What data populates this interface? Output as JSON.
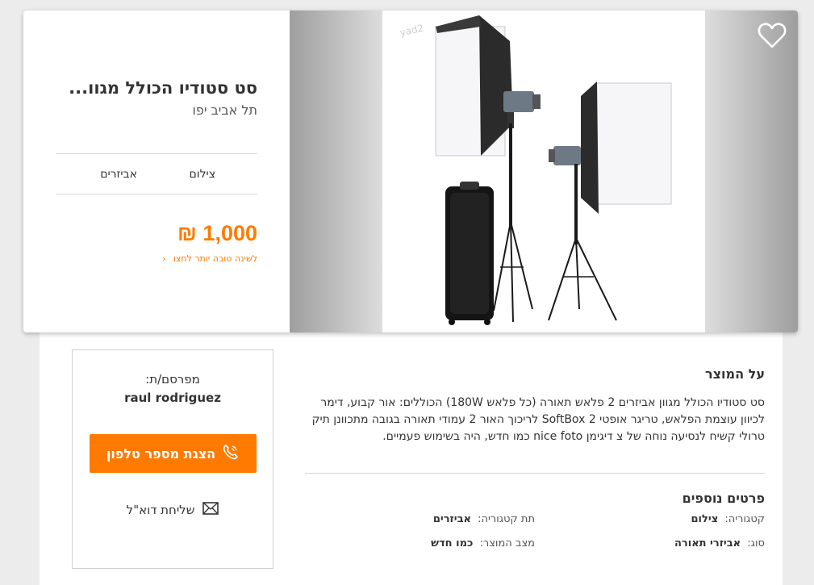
{
  "listing": {
    "title": "סט סטודיו הכולל מגוו...",
    "location": "תל אביב יפו",
    "category": "צילום",
    "subcategory": "אביזרים",
    "price": "1,000 ₪",
    "price_hint": "לשינה טובה יותר לחצו",
    "watermark": "yad2"
  },
  "seller": {
    "label": "מפרסם/ת:",
    "name": "raul rodriguez",
    "phone_button": "הצגת מספר טלפון",
    "email_button": "שליחת דוא\"ל"
  },
  "about": {
    "heading": "על המוצר",
    "description": "סט סטודיו הכולל מגוון אביזרים 2 פלאש תאורה (כל פלאש 180W) הכוללים: אור קבוע, דימר לכיוון עוצמת הפלאש, טריגר אופטי 2 SoftBox לריכוך האור 2 עמודי תאורה בגובה מתכוונן תיק טרולי קשיח לנסיעה נוחה של צ דיגימן nice foto כמו חדש, היה בשימוש פעמיים."
  },
  "details": {
    "heading": "פרטים נוספים",
    "items": [
      {
        "key": "קטגוריה:",
        "value": "צילום"
      },
      {
        "key": "תת קטגוריה:",
        "value": "אביזרים"
      },
      {
        "key": "סוג:",
        "value": "אביזרי תאורה"
      },
      {
        "key": "מצב המוצר:",
        "value": "כמו חדש"
      }
    ]
  },
  "icons": {
    "favorite": "heart-outline-icon",
    "phone": "phone-icon",
    "email": "envelope-icon",
    "chevron": "chevron-left-icon"
  },
  "colors": {
    "accent": "#ff7a00",
    "text": "#333333"
  }
}
